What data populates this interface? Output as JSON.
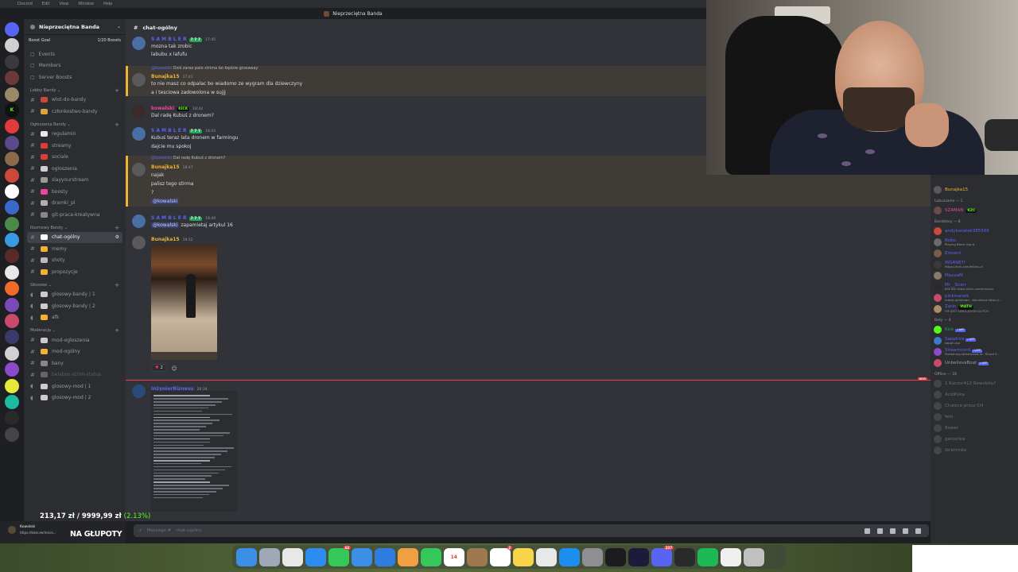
{
  "menubar": {
    "app": "Discord",
    "items": [
      "Edit",
      "View",
      "Window",
      "Help"
    ]
  },
  "window_title": "Nieprzeciętna Banda",
  "server": {
    "name": "Nieprzeciętna Banda",
    "boost_goal": "Boost Goal",
    "boosts": "1/20 Boosts"
  },
  "menu": [
    "Events",
    "Members",
    "Server Boosts"
  ],
  "categories": [
    {
      "name": "Lobby Bandy",
      "channels": [
        {
          "label": "wlot-do-bandy",
          "type": "text",
          "emoji_color": "#c94a3a"
        },
        {
          "label": "członkostwo-bandy",
          "type": "text",
          "emoji_color": "#d9a441"
        }
      ]
    },
    {
      "name": "Ogłoszenia Bandy",
      "channels": [
        {
          "label": "regulamin",
          "type": "text",
          "emoji_color": "#e8e8e8"
        },
        {
          "label": "streamy",
          "type": "text",
          "emoji_color": "#e03b3b"
        },
        {
          "label": "sociale",
          "type": "text",
          "emoji_color": "#e03b3b"
        },
        {
          "label": "ogloszenia",
          "type": "text",
          "emoji_color": "#cfcfcf"
        },
        {
          "label": "slayyourstream",
          "type": "text",
          "emoji_color": "#9a9a9a"
        },
        {
          "label": "boosty",
          "type": "text",
          "emoji_color": "#eb459e"
        },
        {
          "label": "dramki_pl",
          "type": "text",
          "emoji_color": "#b0b0b0"
        },
        {
          "label": "git-praca-kreatywna",
          "type": "text",
          "emoji_color": "#888888"
        }
      ]
    },
    {
      "name": "Rozmowy Bandy",
      "channels": [
        {
          "label": "chat-ogólny",
          "type": "text",
          "emoji_color": "#ffffff",
          "active": true
        },
        {
          "label": "memy",
          "type": "text",
          "emoji_color": "#f0b232"
        },
        {
          "label": "shoty",
          "type": "text",
          "emoji_color": "#bbbbbb"
        },
        {
          "label": "propozycje",
          "type": "text",
          "emoji_color": "#f0b232"
        }
      ]
    },
    {
      "name": "Głosowe",
      "channels": [
        {
          "label": "glosowy-bandy | 1",
          "type": "voice",
          "emoji_color": "#cccccc"
        },
        {
          "label": "glosowy-bandy | 2",
          "type": "voice",
          "emoji_color": "#cccccc"
        },
        {
          "label": "afk",
          "type": "voice",
          "emoji_color": "#f0b232"
        }
      ]
    },
    {
      "name": "Moderacja",
      "channels": [
        {
          "label": "mod-ogloszenia",
          "type": "text",
          "emoji_color": "#cccccc"
        },
        {
          "label": "mod-ogólny",
          "type": "text",
          "emoji_color": "#f0b232"
        },
        {
          "label": "bany",
          "type": "text",
          "emoji_color": "#888888"
        },
        {
          "label": "belabox-strim-status",
          "type": "text",
          "emoji_color": "#666666",
          "muted": true
        },
        {
          "label": "glosowy-mod | 1",
          "type": "voice",
          "emoji_color": "#cccccc"
        },
        {
          "label": "glosowy-mod | 2",
          "type": "voice",
          "emoji_color": "#cccccc"
        }
      ]
    }
  ],
  "channel_header": "chat-ogólny",
  "messages": [
    {
      "author": "S A M B L E R",
      "author_color": "#5865f2",
      "time": "17:45",
      "badge": "7 7 7",
      "avatar": "#4a6fa5",
      "lines": [
        "mozna tak zrobic",
        "labubu x lafufu"
      ]
    },
    {
      "reply_to": "@kowalski",
      "reply_text": "Dziś zaraz pale strima bo będzie giveaway",
      "author": "Bunajka15",
      "author_color": "#f0b232",
      "time": "17:41",
      "avatar": "#5a5a5a",
      "lines": [
        "to nie masz co odpalac bo wiadomo ze wygram dla dziewczyny",
        "a i tesciowa zadowolona w sujjj"
      ],
      "highlight": true
    },
    {
      "author": "kowalski",
      "author_color": "#eb459e",
      "time": "18:42",
      "badge": "KICK",
      "avatar": "#3a2a2a",
      "lines": [
        "Dal radę Kubuś z dronem?"
      ]
    },
    {
      "author": "S A M B L E R",
      "author_color": "#5865f2",
      "time": "18:43",
      "badge": "7 7 7",
      "avatar": "#4a6fa5",
      "lines": [
        "Kubuś teraz lata dronem w farmingu",
        "dajcie mu spokoj"
      ]
    },
    {
      "reply_to": "@kowalski",
      "reply_text": "Dal radę Kubuś z dronem?",
      "author": "Bunajka15",
      "author_color": "#f0b232",
      "time": "18:47",
      "avatar": "#5a5a5a",
      "lines": [
        "najak",
        "palisz tego stirma",
        "?",
        "@kowalski"
      ],
      "highlight": true
    },
    {
      "author": "S A M B L E R",
      "author_color": "#5865f2",
      "time": "18:49",
      "badge": "7 7 7",
      "avatar": "#4a6fa5",
      "mention": "@kowalski",
      "lines": [
        "zapamietaj artykul 16"
      ]
    },
    {
      "author": "Bunajka15",
      "author_color": "#f0b232",
      "time": "19:12",
      "avatar": "#5a5a5a",
      "lines": [],
      "reaction_count": "2"
    },
    {
      "author": "InżynierBiznesu",
      "author_color": "#5865f2",
      "time": "20:34",
      "avatar": "#2a4a7a",
      "lines": []
    }
  ],
  "composer_placeholder": "Message #",
  "composer_channel": "chat-ogólny",
  "overlay": {
    "donation": "213,17 zł / 9999,99 zł",
    "donation_pct": "(2.13%)",
    "banner": "NA GŁUPOTY"
  },
  "user_panel": {
    "name": "Kowalski",
    "sub": "https://tiekr.ee/micro..."
  },
  "members": [
    {
      "category": "",
      "members": [
        {
          "name": "Bunajka15",
          "color": "#f0b232",
          "avatar": "#5a5a5a"
        }
      ]
    },
    {
      "category": "Lubuszanie — 1",
      "members": [
        {
          "name": "SZ4MAN",
          "color": "#eb459e",
          "kick": "KZC",
          "avatar": "#6a4a4a"
        }
      ]
    },
    {
      "category": "Bandziory — 8",
      "members": [
        {
          "name": "andykwiatek385566",
          "color": "#5865f2",
          "avatar": "#c94a3a"
        },
        {
          "name": "Bobo",
          "color": "#5865f2",
          "status": "Playing Black Ops 6",
          "avatar": "#6a6a6a"
        },
        {
          "name": "Eroseni",
          "color": "#5865f2",
          "avatar": "#7a5a4a"
        },
        {
          "name": "INSANE?!",
          "color": "#5865f2",
          "status": "https://kick.com/e5ons-cl",
          "avatar": "#3a3a3a"
        },
        {
          "name": "MaxxaM",
          "color": "#5865f2",
          "avatar": "#8a7a6a"
        },
        {
          "name": "Mr__Scarr",
          "color": "#5865f2",
          "status": "Klik klik https://kirn.com/mrscarr",
          "avatar": "#2a2a2a"
        },
        {
          "name": "pinkmanek",
          "color": "#5865f2",
          "status": "młody pimkman - barcelona https://...",
          "avatar": "#c94a6a"
        },
        {
          "name": "Zarin",
          "color": "#5865f2",
          "kick": "MATH",
          "status": "I'M JUST SIMULATION GLITCH",
          "avatar": "#aa8a6a"
        }
      ]
    },
    {
      "category": "Boty — 4",
      "members": [
        {
          "name": "Kick",
          "color": "#23a55a",
          "app": "APP",
          "avatar": "#53fc18"
        },
        {
          "name": "Sapphire",
          "color": "#5865f2",
          "app": "APP",
          "status": "sapph.xyz",
          "avatar": "#3a7ac9"
        },
        {
          "name": "Streamcord",
          "color": "#5865f2",
          "app": "APP",
          "status": "Streaming streamcord.io - Shard 5...",
          "avatar": "#8a4ac9"
        },
        {
          "name": "UnbelievaBoat",
          "color": "#949ba4",
          "app": "APP",
          "avatar": "#c94a6a"
        }
      ]
    },
    {
      "category": "Offline — 18",
      "offline": true,
      "members": [
        {
          "name": "1 Kaczor412 Rewolota?",
          "avatar": "#6a6a6a"
        },
        {
          "name": "AcidPuka",
          "avatar": "#6a6a6a"
        },
        {
          "name": "Chaloca prosz CH",
          "avatar": "#6a6a6a"
        },
        {
          "name": "felo",
          "avatar": "#6a6a6a"
        },
        {
          "name": "flower",
          "avatar": "#6a6a6a"
        },
        {
          "name": "garzonka",
          "avatar": "#6a6a6a"
        },
        {
          "name": "ibrahimke",
          "avatar": "#6a6a6a"
        }
      ]
    }
  ],
  "dock": [
    {
      "name": "finder-icon",
      "color": "#3b8fe6"
    },
    {
      "name": "launchpad-icon",
      "color": "#a0a8b8"
    },
    {
      "name": "chrome-icon",
      "color": "#e8e8e8"
    },
    {
      "name": "safari-icon",
      "color": "#2c8cf0"
    },
    {
      "name": "messages-icon",
      "color": "#34c759",
      "badge": "62"
    },
    {
      "name": "mail-icon",
      "color": "#3b8fe6"
    },
    {
      "name": "appstore-blue-icon",
      "color": "#2f7de0"
    },
    {
      "name": "photos-icon",
      "color": "#f0a040"
    },
    {
      "name": "facetime-icon",
      "color": "#34c759"
    },
    {
      "name": "calendar-icon",
      "color": "#ffffff",
      "label": "14"
    },
    {
      "name": "notes-brown-icon",
      "color": "#a07850"
    },
    {
      "name": "reminders-icon",
      "color": "#ffffff",
      "badge": "2"
    },
    {
      "name": "notes-icon",
      "color": "#f7d44a"
    },
    {
      "name": "freeform-icon",
      "color": "#e8e8e8"
    },
    {
      "name": "appstore-icon",
      "color": "#1c8ef0"
    },
    {
      "name": "settings-icon",
      "color": "#8e8e93"
    },
    {
      "name": "terminal-icon",
      "color": "#1c1c1e"
    },
    {
      "name": "grid-icon",
      "color": "#1c1c3a"
    },
    {
      "name": "discord-icon",
      "color": "#5865f2",
      "badge": "237"
    },
    {
      "name": "obs-icon",
      "color": "#2a2a2a"
    },
    {
      "name": "spotify-icon",
      "color": "#1db954"
    },
    {
      "name": "document-icon",
      "color": "#f0f0f0"
    },
    {
      "name": "trash-icon",
      "color": "#c0c0c0"
    }
  ]
}
